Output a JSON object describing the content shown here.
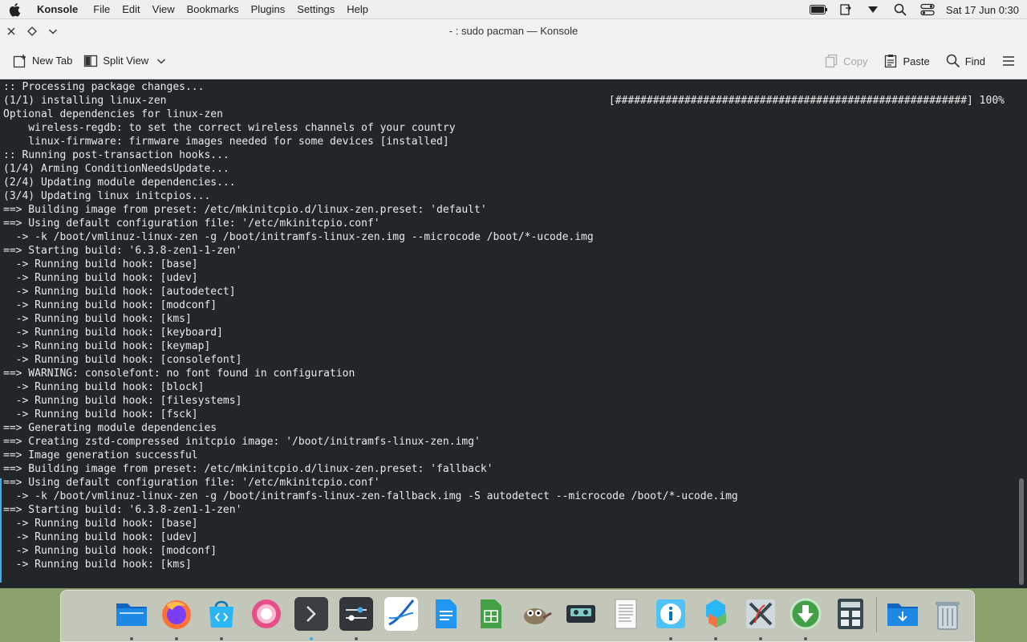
{
  "menubar": {
    "app_name": "Konsole",
    "menus": [
      "File",
      "Edit",
      "View",
      "Bookmarks",
      "Plugins",
      "Settings",
      "Help"
    ],
    "clock": "Sat 17 Jun 0:30"
  },
  "window": {
    "title": "- : sudo pacman — Konsole"
  },
  "toolbar": {
    "new_tab": "New Tab",
    "split_view": "Split View",
    "copy": "Copy",
    "paste": "Paste",
    "find": "Find"
  },
  "terminal": {
    "lines": [
      ":: Processing package changes...",
      "(1/1) installing linux-zen",
      "Optional dependencies for linux-zen",
      "    wireless-regdb: to set the correct wireless channels of your country",
      "    linux-firmware: firmware images needed for some devices [installed]",
      ":: Running post-transaction hooks...",
      "(1/4) Arming ConditionNeedsUpdate...",
      "(2/4) Updating module dependencies...",
      "(3/4) Updating linux initcpios...",
      "==> Building image from preset: /etc/mkinitcpio.d/linux-zen.preset: 'default'",
      "==> Using default configuration file: '/etc/mkinitcpio.conf'",
      "  -> -k /boot/vmlinuz-linux-zen -g /boot/initramfs-linux-zen.img --microcode /boot/*-ucode.img",
      "==> Starting build: '6.3.8-zen1-1-zen'",
      "  -> Running build hook: [base]",
      "  -> Running build hook: [udev]",
      "  -> Running build hook: [autodetect]",
      "  -> Running build hook: [modconf]",
      "  -> Running build hook: [kms]",
      "  -> Running build hook: [keyboard]",
      "  -> Running build hook: [keymap]",
      "  -> Running build hook: [consolefont]",
      "==> WARNING: consolefont: no font found in configuration",
      "  -> Running build hook: [block]",
      "  -> Running build hook: [filesystems]",
      "  -> Running build hook: [fsck]",
      "==> Generating module dependencies",
      "==> Creating zstd-compressed initcpio image: '/boot/initramfs-linux-zen.img'",
      "==> Image generation successful",
      "==> Building image from preset: /etc/mkinitcpio.d/linux-zen.preset: 'fallback'",
      "==> Using default configuration file: '/etc/mkinitcpio.conf'",
      "  -> -k /boot/vmlinuz-linux-zen -g /boot/initramfs-linux-zen-fallback.img -S autodetect --microcode /boot/*-ucode.img",
      "==> Starting build: '6.3.8-zen1-1-zen'",
      "  -> Running build hook: [base]",
      "  -> Running build hook: [udev]",
      "  -> Running build hook: [modconf]",
      "  -> Running build hook: [kms]"
    ],
    "progress": "[########################################################] 100%"
  },
  "dock": {
    "apps": [
      {
        "icon": "file-manager-icon",
        "running": true
      },
      {
        "icon": "firefox-icon",
        "running": true
      },
      {
        "icon": "software-store-icon",
        "running": true
      },
      {
        "icon": "mail-client-icon",
        "running": false
      },
      {
        "icon": "konsole-icon",
        "running": true
      },
      {
        "icon": "system-settings-icon",
        "running": true
      },
      {
        "icon": "image-editor-icon",
        "running": false
      },
      {
        "icon": "writer-icon",
        "running": false
      },
      {
        "icon": "spreadsheet-icon",
        "running": false
      },
      {
        "icon": "gimp-icon",
        "running": false
      },
      {
        "icon": "cassette-player-icon",
        "running": false
      },
      {
        "icon": "text-editor-icon",
        "running": false
      },
      {
        "icon": "info-center-icon",
        "running": true
      },
      {
        "icon": "package-manager-icon",
        "running": true
      },
      {
        "icon": "x11-icon",
        "running": true
      },
      {
        "icon": "downloader-icon",
        "running": true
      },
      {
        "icon": "calculator-icon",
        "running": false
      }
    ],
    "trailing": [
      {
        "icon": "downloads-folder-icon",
        "running": false
      },
      {
        "icon": "trash-icon",
        "running": false
      }
    ]
  },
  "colors": {
    "terminal_bg": "#232629",
    "terminal_fg": "#eaeaea",
    "accent": "#3daee9"
  }
}
